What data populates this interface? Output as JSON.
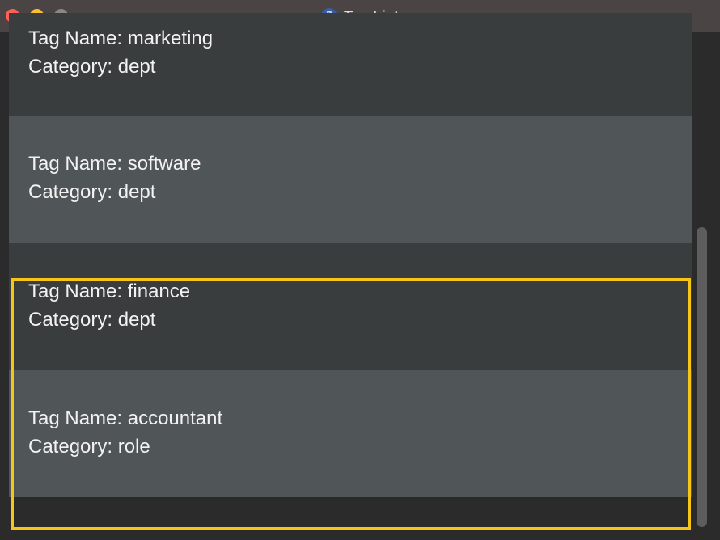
{
  "window": {
    "title": "Tag List",
    "icon": "question-mark-icon"
  },
  "tags": [
    {
      "name_line": "Tag Name: marketing",
      "category_line": "Category: dept"
    },
    {
      "name_line": "Tag Name: software",
      "category_line": "Category: dept"
    },
    {
      "name_line": "Tag Name: finance",
      "category_line": "Category: dept"
    },
    {
      "name_line": "Tag Name: accountant",
      "category_line": "Category: role"
    }
  ],
  "colors": {
    "titlebar": "#4a4544",
    "row_dark": "#3a3d3e",
    "row_light": "#505557",
    "highlight": "#f5c518",
    "background": "#2b2b2b"
  }
}
